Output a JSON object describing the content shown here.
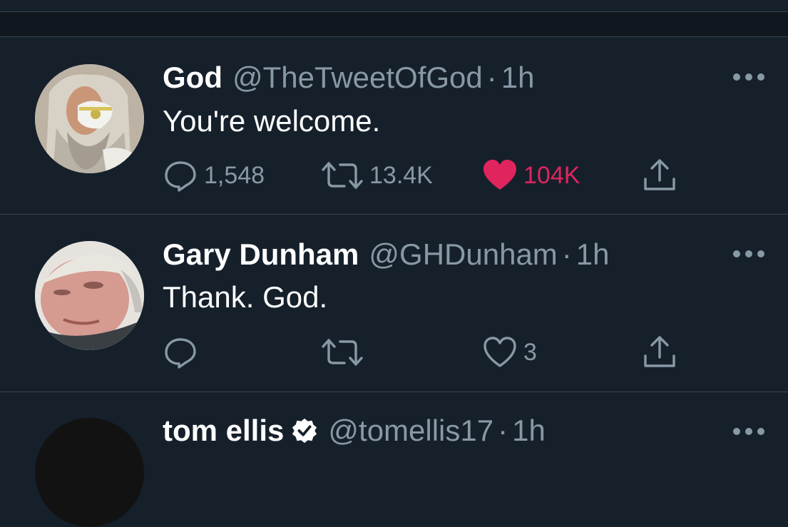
{
  "tweets": [
    {
      "name": "God",
      "handle": "@TheTweetOfGod",
      "separator": "·",
      "time": "1h",
      "text": "You're welcome.",
      "replies": "1,548",
      "retweets": "13.4K",
      "likes": "104K",
      "liked": true
    },
    {
      "name": "Gary Dunham",
      "handle": "@GHDunham",
      "separator": "·",
      "time": "1h",
      "text": "Thank. God.",
      "replies": "",
      "retweets": "",
      "likes": "3",
      "liked": false
    },
    {
      "name": "tom ellis",
      "handle": "@tomellis17",
      "separator": "·",
      "time": "1h",
      "verified": true
    }
  ],
  "icons": {
    "reply": "reply-icon",
    "retweet": "retweet-icon",
    "like": "heart-icon",
    "share": "share-icon",
    "more": "more-options-icon",
    "verified": "verified-badge-icon"
  },
  "colors": {
    "background": "#15202b",
    "secondary_text": "#8899a6",
    "like_active": "#e0245e",
    "divider": "#38444d"
  }
}
